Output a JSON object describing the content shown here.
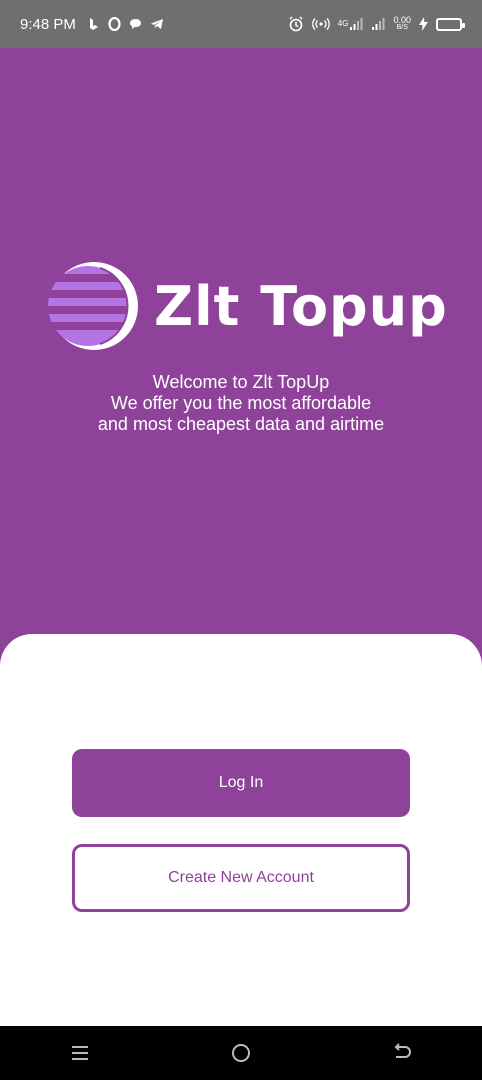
{
  "status_bar": {
    "time": "9:48 PM",
    "network_type": "4G",
    "speed_value": "0.00",
    "speed_unit": "B/S"
  },
  "hero": {
    "logo_text": "Zlt Topup",
    "welcome_line1": "Welcome to Zlt TopUp",
    "welcome_line2": "We offer you the most affordable",
    "welcome_line3": "and most cheapest data and airtime"
  },
  "actions": {
    "login_label": "Log In",
    "create_account_label": "Create New Account"
  },
  "colors": {
    "brand": "#8f429a",
    "status_bar": "#6f6f6f",
    "nav_bar": "#000000"
  }
}
